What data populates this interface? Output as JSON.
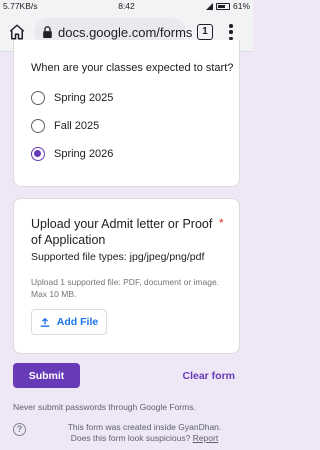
{
  "status_bar": {
    "left_text": "5.77KB/s",
    "time": "8:42",
    "battery": "61%"
  },
  "browser": {
    "url": "docs.google.com/forms",
    "tab_count": "1"
  },
  "question1": {
    "text": "When are your classes expected to start?",
    "options": [
      {
        "label": "Spring 2025",
        "checked": false
      },
      {
        "label": "Fall 2025",
        "checked": false
      },
      {
        "label": "Spring 2026",
        "checked": true
      }
    ]
  },
  "question2": {
    "title": "Upload your Admit letter or Proof of Application",
    "required_mark": "*",
    "file_types": "Supported file types: jpg/jpeg/png/pdf",
    "hint": "Upload 1 supported file: PDF, document or image. Max 10 MB.",
    "add_file_label": "Add File"
  },
  "actions": {
    "submit_label": "Submit",
    "clear_label": "Clear form"
  },
  "footer": {
    "warning": "Never submit passwords through Google Forms.",
    "created_text": "This form was created inside GyanDhan.",
    "suspicious_text": "Does this form look suspicious?",
    "report_label": "Report"
  },
  "colors": {
    "accent": "#673ab7",
    "background": "#ede7f6",
    "link": "#1a73e8",
    "required": "#d93025"
  }
}
